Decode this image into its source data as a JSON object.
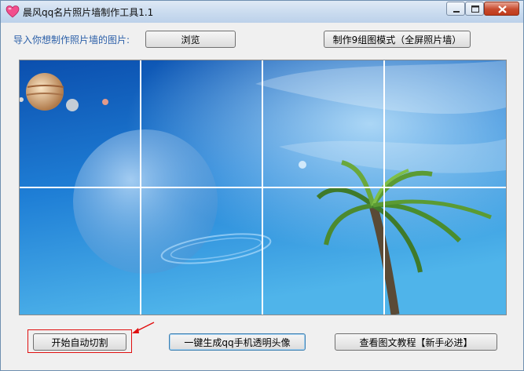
{
  "window": {
    "title": "晨风qq名片照片墙制作工具1.1"
  },
  "toolbar": {
    "import_label": "导入你想制作照片墙的图片:",
    "browse_label": "浏览",
    "nine_grid_label": "制作9组图模式（全屏照片墙）"
  },
  "actions": {
    "auto_cut_label": "开始自动切割",
    "transparent_avatar_label": "一键生成qq手机透明头像",
    "tutorial_label": "查看图文教程【新手必进】"
  },
  "colors": {
    "accent": "#2b5fa8",
    "highlight": "#e01010",
    "sky_top": "#0b4fae",
    "sky_bottom": "#4fb4ea"
  },
  "icons": {
    "app": "heart-icon",
    "minimize": "minimize-icon",
    "maximize": "maximize-icon",
    "close": "close-icon",
    "annotation": "arrow-icon"
  }
}
